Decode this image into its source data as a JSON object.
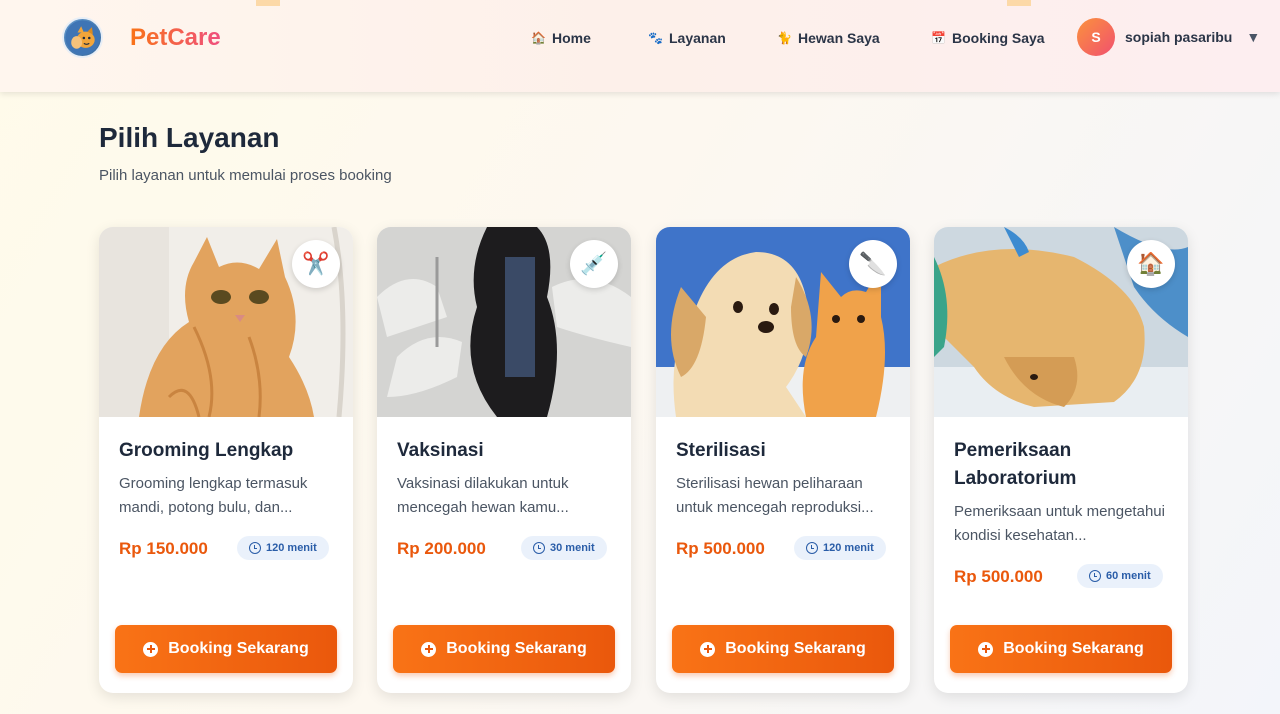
{
  "header": {
    "brand": "PetCare",
    "logo_icon": "pet-logo-icon",
    "nav": [
      {
        "label": "Home",
        "icon": "house-icon",
        "glyph": "🏠"
      },
      {
        "label": "Layanan",
        "icon": "paw-icon",
        "glyph": "🐾"
      },
      {
        "label": "Hewan Saya",
        "icon": "cat-icon",
        "glyph": "🐈"
      },
      {
        "label": "Booking Saya",
        "icon": "calendar-icon",
        "glyph": "📅"
      }
    ],
    "user": {
      "initial": "S",
      "name": "sopiah pasaribu",
      "caret": "▼"
    }
  },
  "page": {
    "title": "Pilih Layanan",
    "subtitle": "Pilih layanan untuk memulai proses booking"
  },
  "services": [
    {
      "title": "Grooming Lengkap",
      "description": "Grooming lengkap termasuk mandi, potong bulu, dan...",
      "price": "Rp 150.000",
      "duration": "120 menit",
      "badge_icon": "scissors-icon",
      "badge_glyph": "✂️",
      "image": "wet-cat-photo",
      "button": "Booking Sekarang"
    },
    {
      "title": "Vaksinasi",
      "description": "Vaksinasi dilakukan untuk mencegah hewan kamu...",
      "price": "Rp 200.000",
      "duration": "30 menit",
      "badge_icon": "syringe-icon",
      "badge_glyph": "💉",
      "image": "vaccination-photo",
      "button": "Booking Sekarang"
    },
    {
      "title": "Sterilisasi",
      "description": "Sterilisasi hewan peliharaan untuk mencegah reproduksi...",
      "price": "Rp 500.000",
      "duration": "120 menit",
      "badge_icon": "knife-icon",
      "badge_glyph": "🔪",
      "image": "puppy-kitten-photo",
      "button": "Booking Sekarang"
    },
    {
      "title": "Pemeriksaan Laboratorium",
      "description": "Pemeriksaan untuk mengetahui kondisi kesehatan...",
      "price": "Rp 500.000",
      "duration": "60 menit",
      "badge_icon": "house-icon",
      "badge_glyph": "🏠",
      "image": "dog-on-exam-table-photo",
      "button": "Booking Sekarang"
    }
  ],
  "colors": {
    "accent": "#ea580c",
    "brand_start": "#f97316",
    "brand_end": "#ef4f7f",
    "duration_bg": "#eaf1fb",
    "duration_text": "#2a5da8"
  }
}
